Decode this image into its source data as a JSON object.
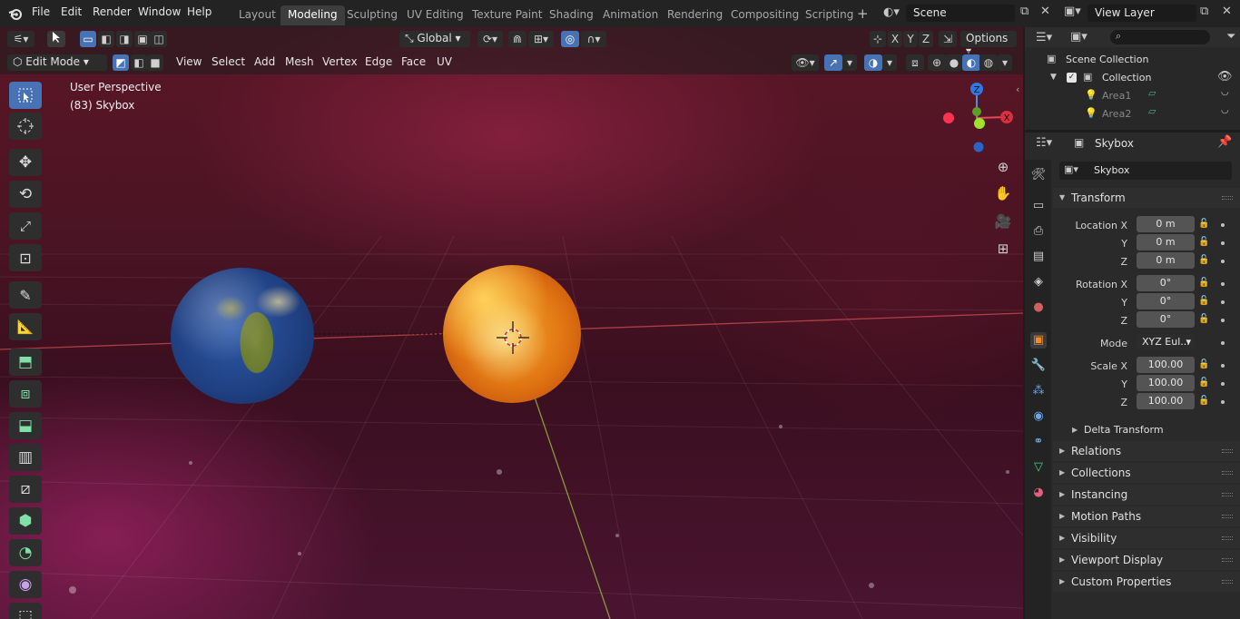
{
  "menu": [
    "File",
    "Edit",
    "Render",
    "Window",
    "Help"
  ],
  "workspaces": [
    {
      "label": "Layout",
      "active": false
    },
    {
      "label": "Modeling",
      "active": true
    },
    {
      "label": "Sculpting",
      "active": false
    },
    {
      "label": "UV Editing",
      "active": false
    },
    {
      "label": "Texture Paint",
      "active": false
    },
    {
      "label": "Shading",
      "active": false
    },
    {
      "label": "Animation",
      "active": false
    },
    {
      "label": "Rendering",
      "active": false
    },
    {
      "label": "Compositing",
      "active": false
    },
    {
      "label": "Scripting",
      "active": false
    }
  ],
  "scene": "Scene",
  "view_layer": "View Layer",
  "viewport": {
    "orientation": "Global",
    "options": "Options",
    "mode": "Edit Mode",
    "header_menu": [
      "View",
      "Select",
      "Add",
      "Mesh",
      "Vertex",
      "Edge",
      "Face",
      "UV"
    ],
    "perspective": "User Perspective",
    "object_info": "(83) Skybox",
    "axes": {
      "x": "X",
      "y": "Y",
      "z": "Z"
    }
  },
  "outliner": {
    "root": "Scene Collection",
    "collection": "Collection",
    "items": [
      "Area1",
      "Area2"
    ]
  },
  "properties": {
    "header_object": "Skybox",
    "object_name": "Skybox",
    "transform_title": "Transform",
    "location": {
      "label": "Location X",
      "x": "0 m",
      "y": "0 m",
      "z": "0 m"
    },
    "rotation": {
      "label": "Rotation X",
      "x": "0°",
      "y": "0°",
      "z": "0°"
    },
    "mode_label": "Mode",
    "mode_value": "XYZ Eul...",
    "scale": {
      "label": "Scale X",
      "x": "100.00",
      "y": "100.00",
      "z": "100.00"
    },
    "axis_y": "Y",
    "axis_z": "Z",
    "delta": "Delta Transform",
    "panels": [
      "Relations",
      "Collections",
      "Instancing",
      "Motion Paths",
      "Visibility",
      "Viewport Display",
      "Custom Properties"
    ]
  }
}
